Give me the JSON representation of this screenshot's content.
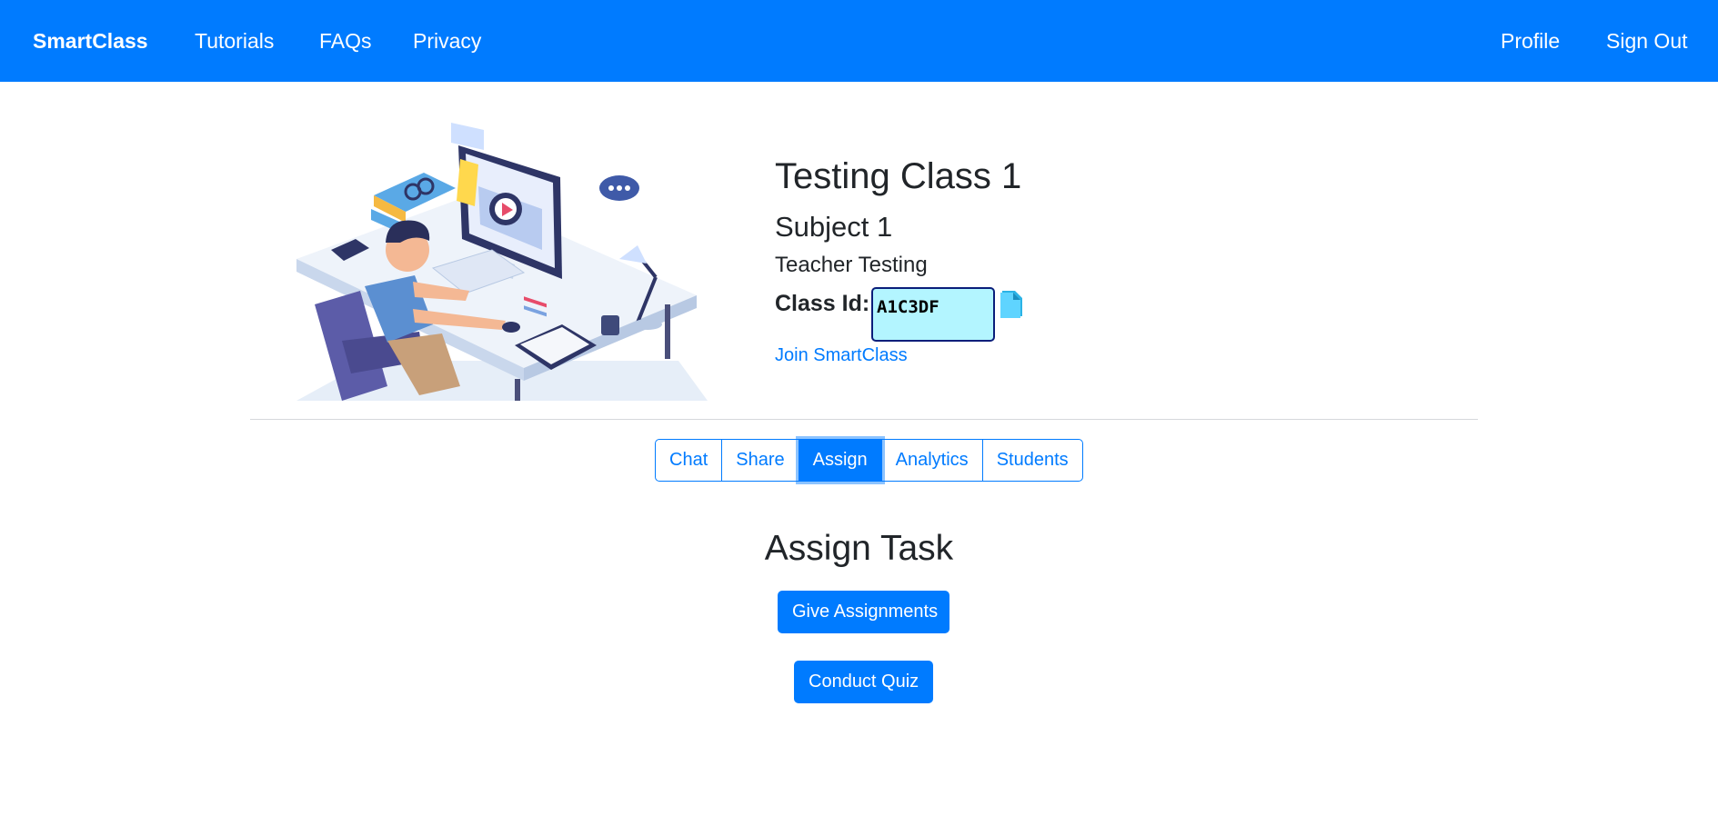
{
  "navbar": {
    "brand": "SmartClass",
    "links": [
      "Tutorials",
      "FAQs",
      "Privacy"
    ],
    "right_links": [
      "Profile",
      "Sign Out"
    ]
  },
  "class_info": {
    "title": "Testing Class 1",
    "subject": "Subject 1",
    "teacher": "Teacher Testing",
    "class_id_label": "Class Id:",
    "class_id_value": "A1C3DF",
    "join_link": "Join SmartClass"
  },
  "tabs": [
    {
      "label": "Chat",
      "active": false
    },
    {
      "label": "Share",
      "active": false
    },
    {
      "label": "Assign",
      "active": true
    },
    {
      "label": "Analytics",
      "active": false
    },
    {
      "label": "Students",
      "active": false
    }
  ],
  "assign": {
    "heading": "Assign Task",
    "give_button": "Give Assignments",
    "quiz_button": "Conduct Quiz"
  },
  "icons": {
    "copy": "copy-icon",
    "hero": "online-class-illustration"
  },
  "colors": {
    "primary": "#007bff",
    "class_id_bg": "#b3f5ff",
    "class_id_border": "#0a1e7a"
  }
}
